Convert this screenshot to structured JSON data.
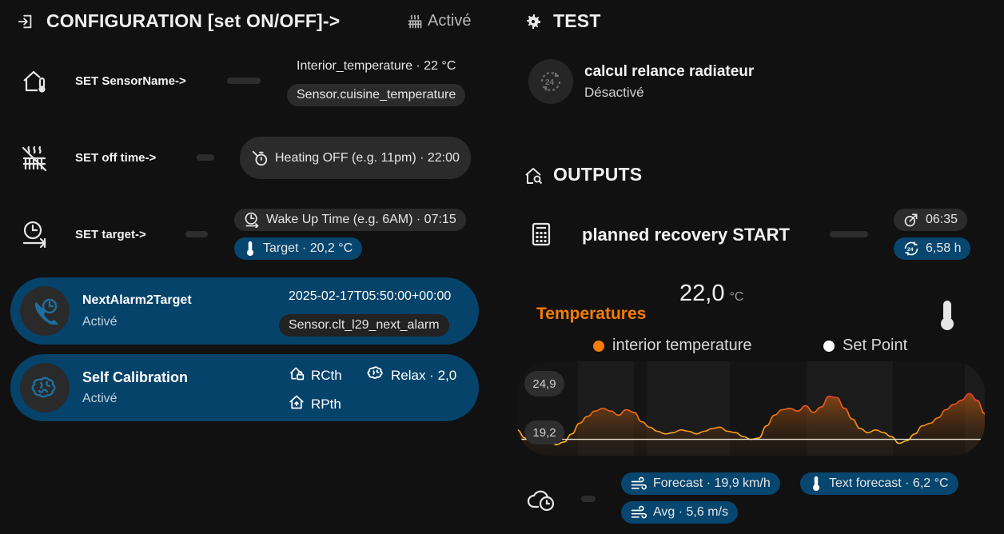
{
  "config": {
    "title": "CONFIGURATION [set ON/OFF]->",
    "status": "Activé",
    "sensor_row": {
      "label": "SET SensorName->",
      "value_text": "Interior_temperature · 22 °C",
      "chip": "Sensor.cuisine_temperature"
    },
    "offtime_row": {
      "label": "SET off time->",
      "chip": "Heating OFF (e.g. 11pm) · 22:00"
    },
    "target_row": {
      "label": "SET target->",
      "chip_wake": "Wake Up Time (e.g. 6AM) · 07:15",
      "chip_target": "Target · 20,2 °C"
    },
    "alarm_card": {
      "title": "NextAlarm2Target",
      "status": "Activé",
      "value": "2025-02-17T05:50:00+00:00",
      "chip": "Sensor.clt_l29_next_alarm"
    },
    "calib_card": {
      "title": "Self Calibration",
      "status": "Activé",
      "rcth": "RCth",
      "relax": "Relax · 2,0",
      "rpth": "RPth"
    }
  },
  "test": {
    "title": "TEST",
    "item_title": "calcul relance radiateur",
    "item_status": "Désactivé"
  },
  "outputs": {
    "title": "OUTPUTS",
    "recovery_label": "planned recovery START",
    "time_chip": "06:35",
    "hours_chip": "6,58 h",
    "current_value": "22,0",
    "current_unit": "°C",
    "graph_title": "Temperatures",
    "legend": [
      {
        "name": "interior temperature",
        "color": "#f57c00"
      },
      {
        "name": "Set Point",
        "color": "#ffffff"
      }
    ],
    "axis_max_label": "24,9",
    "axis_min_label": "19,2",
    "weather_chips": {
      "forecast": "Forecast · 19,9 km/h",
      "text_forecast": "Text forecast · 6,2 °C",
      "avg": "Avg · 5,6 m/s"
    }
  },
  "chart_data": {
    "type": "area",
    "title": "Temperatures",
    "ylim": [
      19.2,
      24.9
    ],
    "series": [
      {
        "name": "interior temperature",
        "color": "#f57c00",
        "values": [
          20.4,
          19.8,
          19.5,
          19.4,
          19.6,
          19.3,
          19.5,
          20.1,
          20.9,
          21.4,
          21.8,
          22.0,
          21.8,
          21.5,
          21.9,
          21.7,
          21.0,
          20.6,
          20.3,
          20.1,
          20.2,
          20.4,
          20.3,
          20.1,
          20.3,
          20.5,
          20.6,
          20.3,
          20.2,
          19.9,
          19.7,
          19.8,
          20.7,
          21.5,
          21.9,
          22.0,
          21.8,
          22.2,
          21.7,
          22.1,
          22.9,
          22.8,
          22.0,
          21.2,
          20.5,
          20.2,
          20.4,
          20.2,
          19.9,
          19.4,
          19.6,
          20.1,
          20.7,
          20.9,
          21.3,
          21.9,
          22.3,
          22.6,
          23.1,
          22.6,
          21.6
        ]
      },
      {
        "name": "Set Point",
        "color": "#ffffff",
        "values": [
          19.7,
          19.7
        ]
      }
    ]
  }
}
